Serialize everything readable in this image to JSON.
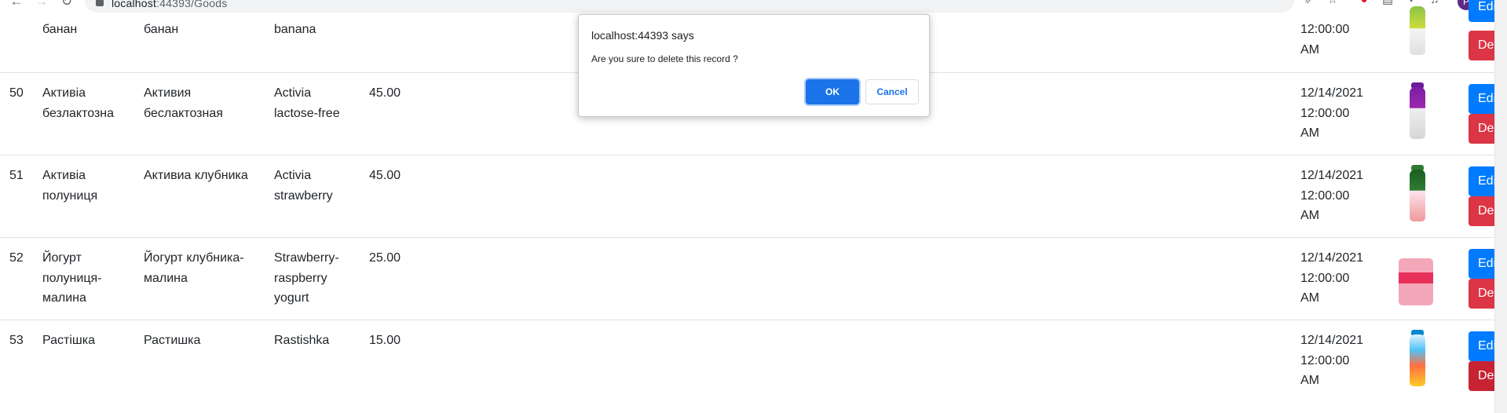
{
  "browser": {
    "url_host": "localhost",
    "url_path": ":44393/Goods",
    "back_icon": "arrow-left-icon",
    "forward_icon": "arrow-right-icon",
    "reload_icon": "reload-icon",
    "avatar_letter": "P"
  },
  "dialog": {
    "title": "localhost:44393 says",
    "message": "Are you sure to delete this record ?",
    "ok_label": "OK",
    "cancel_label": "Cancel"
  },
  "rows": [
    {
      "id": "",
      "name_ua": "банан",
      "name_ru": "банан",
      "name_en": "banana",
      "price": "",
      "date": [
        "",
        "12:00:00",
        "AM"
      ],
      "edit_label": "Edit",
      "delete_label": "Delete"
    },
    {
      "id": "50",
      "name_ua": [
        "Активіа",
        "безлактозна"
      ],
      "name_ru": [
        "Активия",
        "беслактозная"
      ],
      "name_en": [
        "Activia",
        "lactose-free"
      ],
      "price": "45.00",
      "date": [
        "12/14/2021",
        "12:00:00",
        "AM"
      ],
      "edit_label": "Edit",
      "delete_label": "Delete"
    },
    {
      "id": "51",
      "name_ua": [
        "Активіа",
        "полуниця"
      ],
      "name_ru": [
        "Активиа клубника"
      ],
      "name_en": [
        "Activia",
        "strawberry"
      ],
      "price": "45.00",
      "date": [
        "12/14/2021",
        "12:00:00",
        "AM"
      ],
      "edit_label": "Edit",
      "delete_label": "Delete"
    },
    {
      "id": "52",
      "name_ua": [
        "Йогурт",
        "полуниця-",
        "малина"
      ],
      "name_ru": [
        "Йогурт клубника-",
        "малина"
      ],
      "name_en": [
        "Strawberry-",
        "raspberry",
        "yogurt"
      ],
      "price": "25.00",
      "date": [
        "12/14/2021",
        "12:00:00",
        "AM"
      ],
      "edit_label": "Edit",
      "delete_label": "Delete"
    },
    {
      "id": "53",
      "name_ua": [
        "Растішка"
      ],
      "name_ru": [
        "Растишка"
      ],
      "name_en": [
        "Rastishka"
      ],
      "price": "15.00",
      "date": [
        "12/14/2021",
        "12:00:00",
        "AM"
      ],
      "edit_label": "Edit",
      "delete_label": "Delete"
    }
  ],
  "colors": {
    "edit": "#007bff",
    "delete": "#dc3545",
    "dialog_ok": "#1a73e8"
  }
}
